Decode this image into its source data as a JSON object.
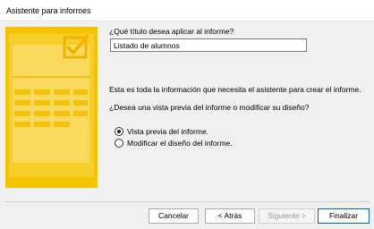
{
  "window": {
    "title": "Asistente para informes"
  },
  "form": {
    "question_title": "¿Qué título desea aplicar al informe?",
    "title_value": "Listado de alumnos",
    "info_text": "Esta es toda la información que necesita el asistente para crear el informe.",
    "question_preview": "¿Desea una vista previa del informe o modificar su diseño?",
    "options": [
      {
        "label": "Vista previa del informe.",
        "checked": true
      },
      {
        "label": "Modificar el diseño del informe.",
        "checked": false
      }
    ]
  },
  "buttons": {
    "cancel": "Cancelar",
    "back": "< Atrás",
    "next": "Siguiente >",
    "finish": "Finalizar"
  },
  "colors": {
    "illustration_yellow": "#f5c400",
    "illustration_light": "#fbe38a"
  }
}
